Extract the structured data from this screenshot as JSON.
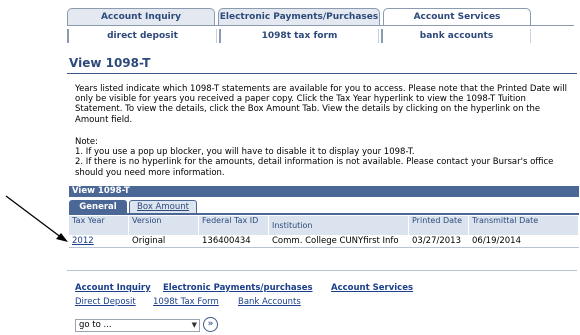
{
  "tabs": [
    "Account Inquiry",
    "Electronic Payments/Purchases",
    "Account Services"
  ],
  "subtabs": [
    "direct deposit",
    "1098t tax form",
    "bank accounts"
  ],
  "page_title": "View 1098-T",
  "intro": "Years listed indicate which 1098-T statements are available for you to access.  Please note that the Printed Date will only be visible for years you received a paper copy. Click the Tax Year hyperlink to view the 1098-T Tuition Statement.  To view the details, click the Box Amount Tab.  View the details by clicking on the hyperlink on the Amount field.",
  "note": {
    "heading": "Note:",
    "item1": "1.  If you use a pop up blocker, you will have to disable it to display your 1098-T.",
    "item2": "2.  If there is no hyperlink for the amounts, detail information is not available.  Please contact your Bursar's office should you need more information."
  },
  "grid": {
    "title": "View 1098-T",
    "tabs": [
      "General",
      "Box Amount"
    ],
    "columns": [
      "Tax Year",
      "Version",
      "Federal Tax ID",
      "Institution",
      "Printed Date",
      "Transmittal Date"
    ],
    "rows": [
      [
        "2012",
        "Original",
        "136400434",
        "Comm. College CUNYfirst Info",
        "03/27/2013",
        "06/19/2014"
      ]
    ]
  },
  "footer_links_row1": [
    "Account Inquiry",
    "Electronic Payments/purchases",
    "Account Services"
  ],
  "footer_links_row2": [
    "Direct Deposit",
    "1098t Tax Form",
    "Bank Accounts"
  ],
  "goto": {
    "selected": "go to ..."
  },
  "colors": {
    "accent": "#2d4a7b",
    "grid_header": "#4a6796"
  }
}
